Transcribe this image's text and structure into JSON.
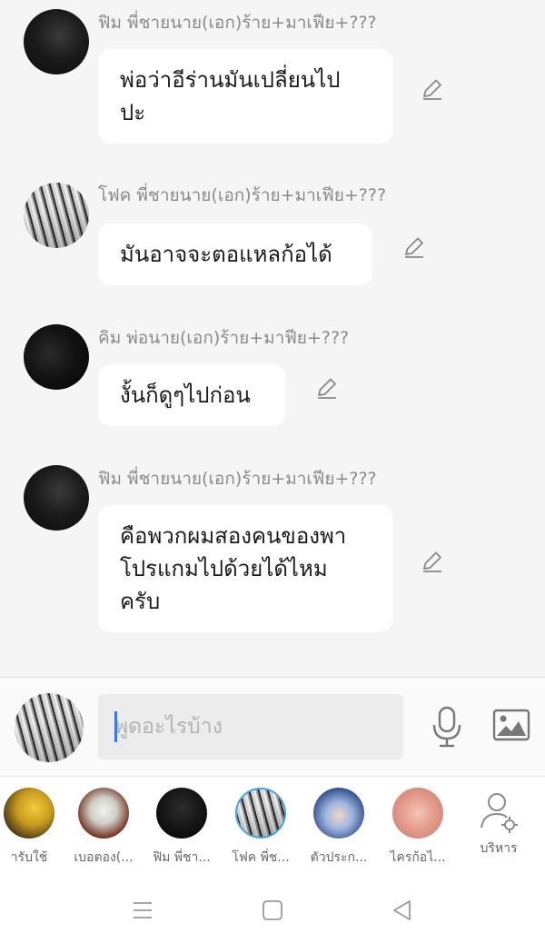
{
  "messages": [
    {
      "sender": "ฟิม พี่ชายนาย(เอก)ร้าย+มาเฟีย+???",
      "lines": [
        "พ่อว่าอีร่านมันเปลี่ยนไป",
        "ปะ"
      ]
    },
    {
      "sender": "โฟค พี่ชายนาย(เอก)ร้าย+มาเฟีย+???",
      "lines": [
        "มันอาจจะตอแหลก้อได้"
      ]
    },
    {
      "sender": "คิม พ่อนาย(เอก)ร้าย+มาฟีย+???",
      "lines": [
        "งั้นก็ดูๆไปก่อน"
      ]
    },
    {
      "sender": "ฟิม พี่ชายนาย(เอก)ร้าย+มาเฟีย+???",
      "lines": [
        "คือพวกผมสองคนของพา",
        "โปรแกมไปด้วยได้ไหม",
        "ครับ"
      ]
    }
  ],
  "composer": {
    "placeholder": "พูดอะไรบ้าง"
  },
  "tabs": [
    {
      "label": "ารับใช้"
    },
    {
      "label": "เบอตอง(..."
    },
    {
      "label": "ฟิม พี่ชา..."
    },
    {
      "label": "โฟค พี่ช..."
    },
    {
      "label": "ตัวประก..."
    },
    {
      "label": "ไครก้อไ..."
    },
    {
      "label": "บริหาร"
    }
  ],
  "colors": {
    "background": "#f5f5f5",
    "bubble": "#ffffff",
    "caret": "#2d7cf6",
    "selected_ring": "#4aa3e6"
  },
  "icons": [
    "edit-pencil-icon",
    "microphone-icon",
    "image-icon",
    "admin-settings-icon",
    "menu-icon",
    "home-square-icon",
    "back-triangle-icon"
  ]
}
